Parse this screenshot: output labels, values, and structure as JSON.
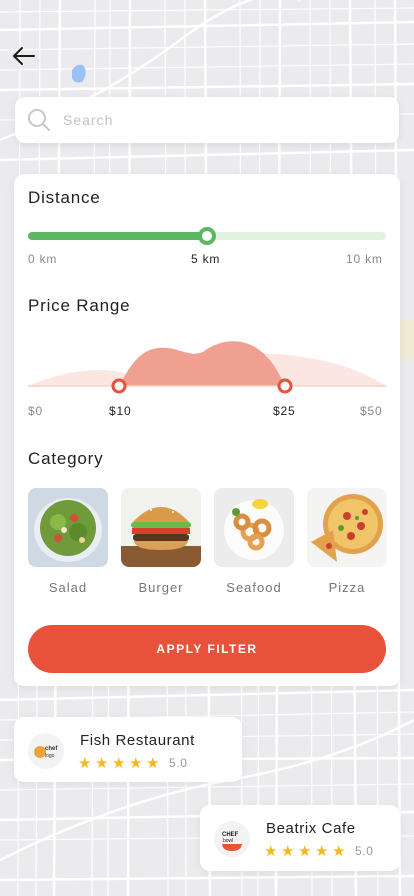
{
  "search": {
    "placeholder": "Search"
  },
  "filter": {
    "distance": {
      "title": "Distance",
      "min_label": "0 km",
      "value_label": "5 km",
      "max_label": "10 km",
      "value_fraction": 0.5,
      "colors": {
        "fill": "#5db760",
        "track": "#e3f1e1"
      }
    },
    "price": {
      "title": "Price Range",
      "min_label": "$0",
      "low_label": "$10",
      "high_label": "$25",
      "max_label": "$50",
      "low_value": 10,
      "high_value": 25,
      "max_value": 50,
      "colors": {
        "accent": "#e8513a",
        "area": "#f6d9d3"
      }
    },
    "category": {
      "title": "Category",
      "items": [
        {
          "label": "Salad",
          "icon": "salad-image"
        },
        {
          "label": "Burger",
          "icon": "burger-image"
        },
        {
          "label": "Seafood",
          "icon": "seafood-image"
        },
        {
          "label": "Pizza",
          "icon": "pizza-image"
        }
      ]
    },
    "apply_label": "APPLY FILTER"
  },
  "restaurants": [
    {
      "name": "Fish Restaurant",
      "logo_text": "chef logo",
      "rating": "5.0",
      "stars": 5
    },
    {
      "name": "Beatrix Cafe",
      "logo_text": "CHEF bowl",
      "rating": "5.0",
      "stars": 5
    }
  ],
  "colors": {
    "accent": "#e8513a",
    "green": "#5db760",
    "star": "#f5b81e"
  }
}
